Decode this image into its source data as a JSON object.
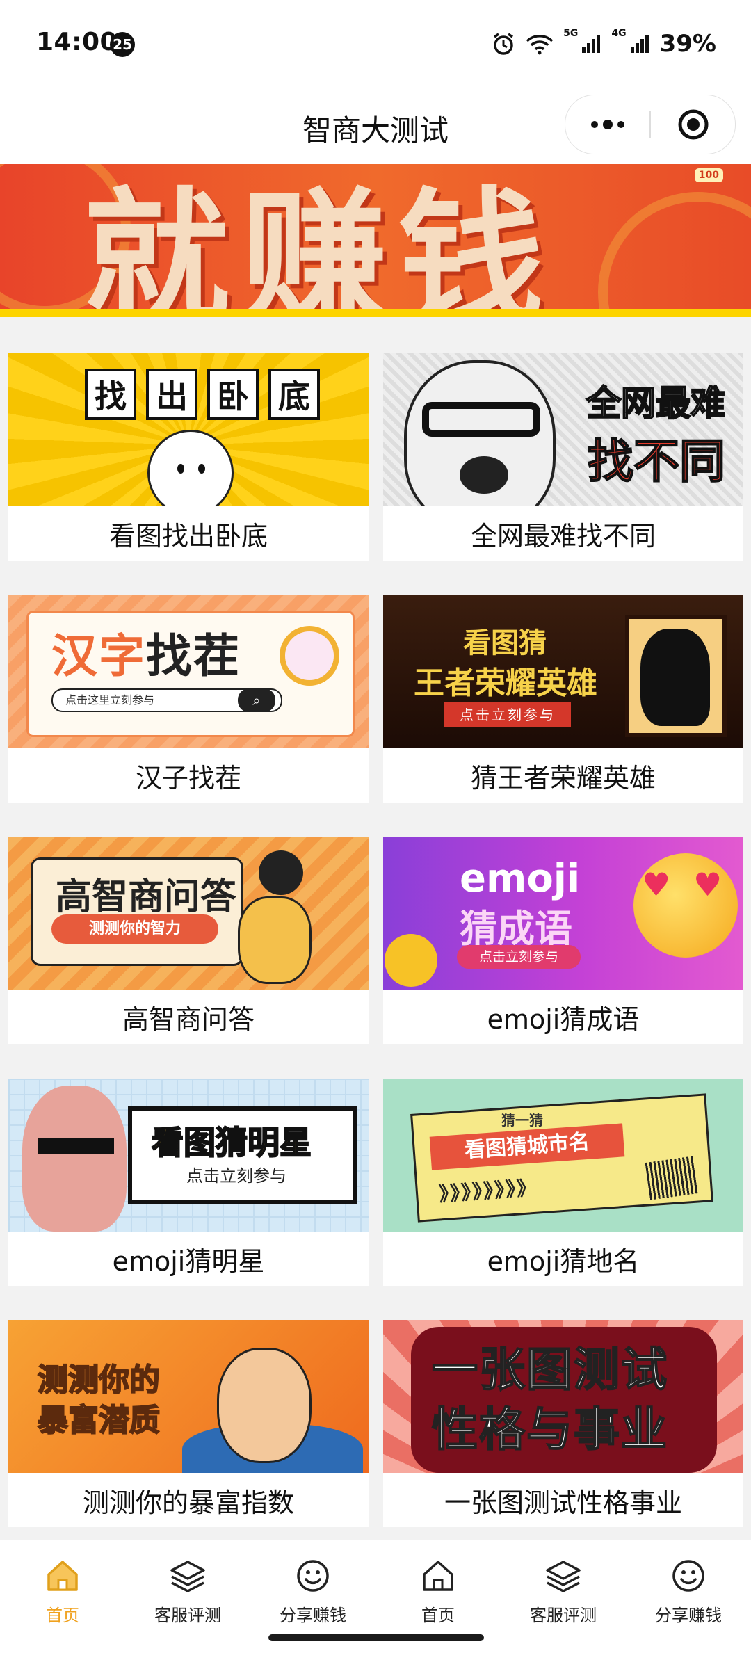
{
  "status_bar": {
    "time": "14:00",
    "notification_count": "25",
    "battery": "39%",
    "net1": "5G",
    "net2": "4G"
  },
  "nav": {
    "title": "智商大测试"
  },
  "banner": {
    "text": "就赚钱",
    "badge": "100"
  },
  "cards": [
    {
      "label": "看图找出卧底",
      "thumb_text": [
        "找",
        "出",
        "卧",
        "底"
      ]
    },
    {
      "label": "全网最难找不同",
      "thumb_text": [
        "全网最难",
        "找不同"
      ]
    },
    {
      "label": "汉子找茬",
      "thumb_text": [
        "汉字",
        "找茬",
        "点击这里立刻参与"
      ]
    },
    {
      "label": "猜王者荣耀英雄",
      "thumb_text": [
        "看图猜",
        "王者荣耀英雄",
        "点击立刻参与"
      ]
    },
    {
      "label": "高智商问答",
      "thumb_text": [
        "高智商问答",
        "测测你的智力"
      ]
    },
    {
      "label": "emoji猜成语",
      "thumb_text": [
        "emoji",
        "猜成语",
        "点击立刻参与"
      ]
    },
    {
      "label": "emoji猜明星",
      "thumb_text": [
        "看图猜明星",
        "点击立刻参与"
      ]
    },
    {
      "label": "emoji猜地名",
      "thumb_text": [
        "猜一猜",
        "看图猜城市名",
        "》》》》》》》》"
      ]
    },
    {
      "label": "测测你的暴富指数",
      "thumb_text": [
        "测测你的",
        "暴富潜质"
      ]
    },
    {
      "label": "一张图测试性格事业",
      "thumb_text": [
        "一张图测试",
        "性格与事业"
      ]
    }
  ],
  "tabbar": {
    "items": [
      {
        "label": "首页",
        "icon": "home-icon",
        "active": true
      },
      {
        "label": "客服评测",
        "icon": "layers-icon",
        "active": false
      },
      {
        "label": "分享赚钱",
        "icon": "smile-icon",
        "active": false
      },
      {
        "label": "首页",
        "icon": "home-icon",
        "active": false
      },
      {
        "label": "客服评测",
        "icon": "layers-icon",
        "active": false
      },
      {
        "label": "分享赚钱",
        "icon": "smile-icon",
        "active": false
      }
    ]
  },
  "colors": {
    "accent": "#f0a21f",
    "banner_red": "#e8442a",
    "banner_yellow": "#fdd400"
  }
}
